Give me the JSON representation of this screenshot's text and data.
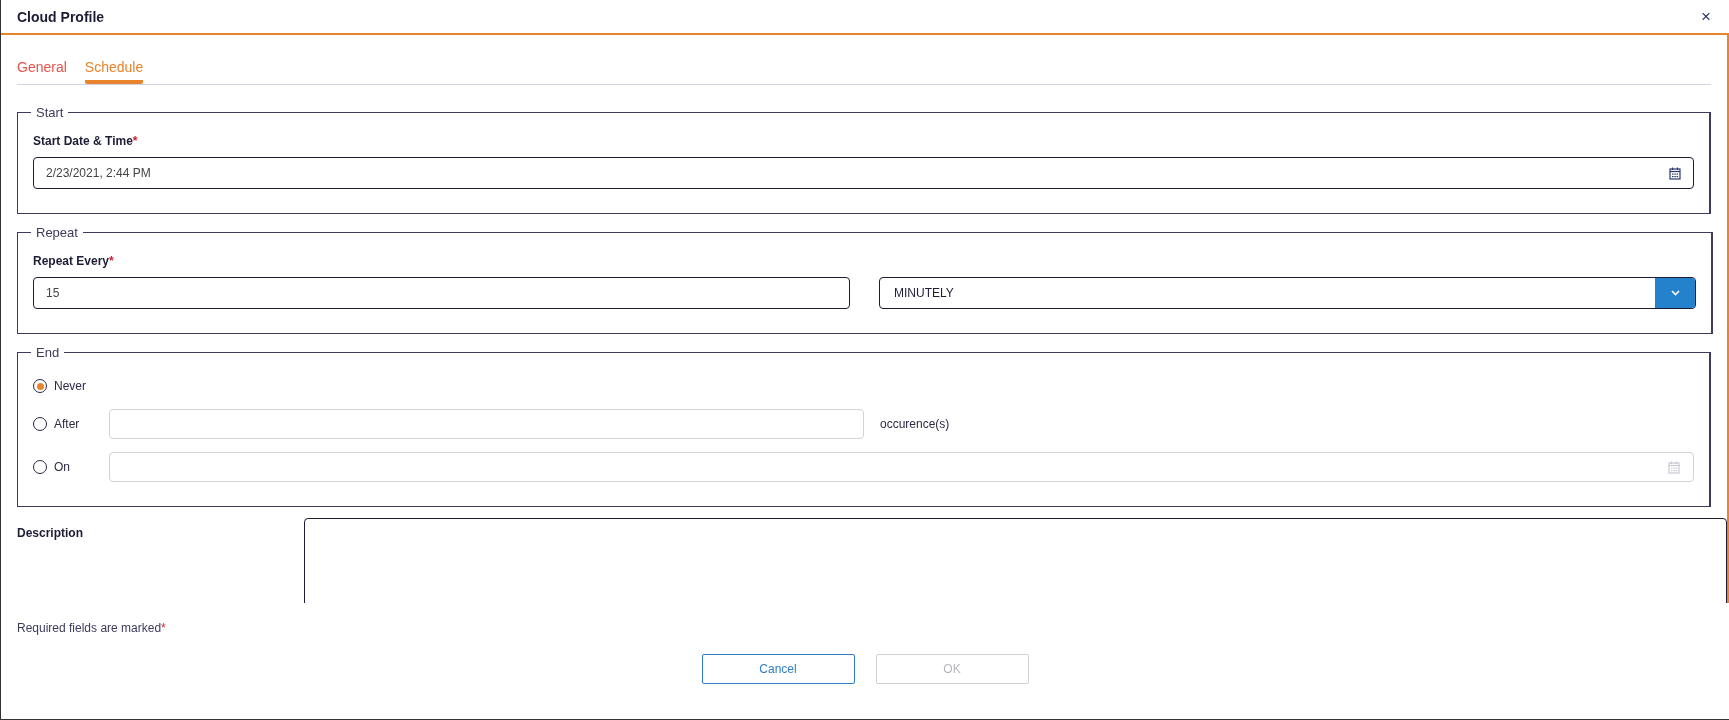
{
  "window": {
    "title": "Cloud Profile",
    "close": "×"
  },
  "tabs": [
    {
      "label": "General",
      "selected": false
    },
    {
      "label": "Schedule",
      "selected": true
    }
  ],
  "start": {
    "legend": "Start",
    "label": "Start Date & Time",
    "required_mark": "*",
    "value": "2/23/2021, 2:44 PM"
  },
  "repeat": {
    "legend": "Repeat",
    "label": "Repeat Every",
    "required_mark": "*",
    "interval": "15",
    "frequency": "MINUTELY"
  },
  "end": {
    "legend": "End",
    "options": [
      {
        "kind": "plain",
        "label": "Never",
        "selected": true
      },
      {
        "kind": "number",
        "label": "After",
        "selected": false,
        "disabled": true,
        "suffix": "occurence(s)"
      },
      {
        "kind": "date",
        "label": "On",
        "selected": false,
        "disabled": true
      }
    ]
  },
  "description": {
    "label": "Description"
  },
  "required_note": {
    "text": "Required fields are marked",
    "mark": "*"
  },
  "buttons": [
    {
      "label": "Cancel",
      "disabled": false
    },
    {
      "label": "OK",
      "disabled": true
    }
  ]
}
